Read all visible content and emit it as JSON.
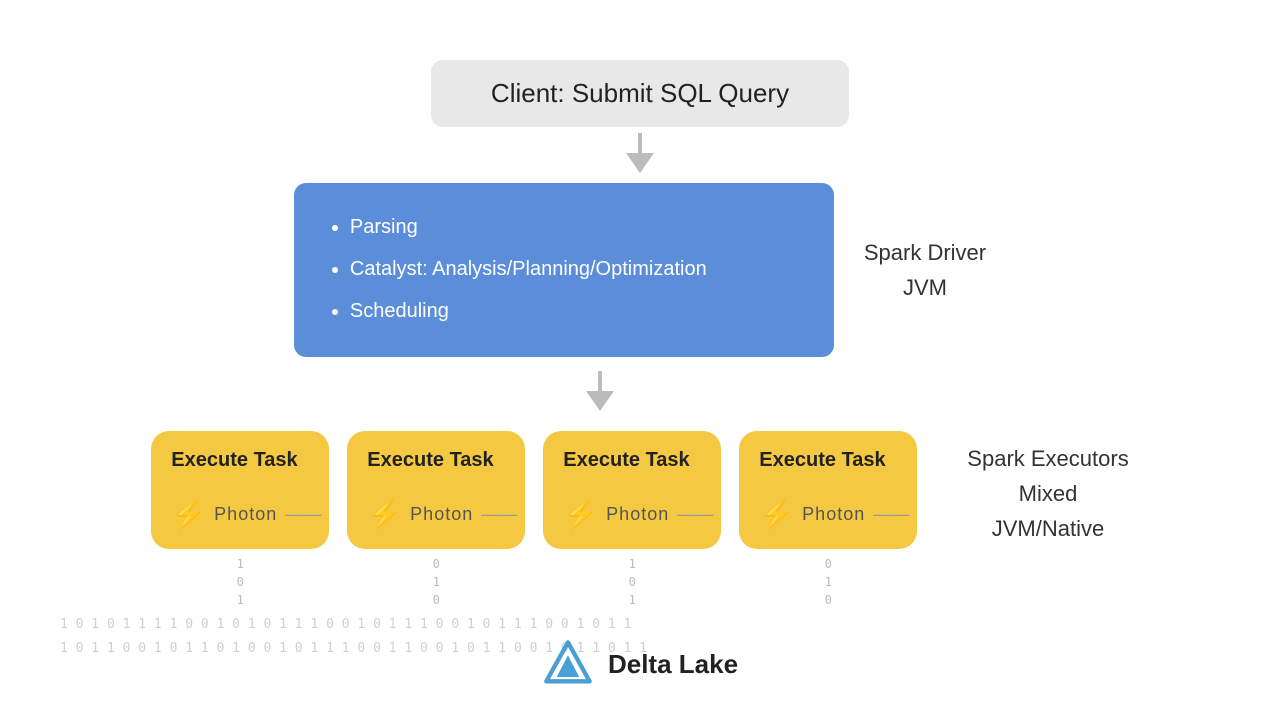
{
  "client": {
    "label": "Client: Submit SQL Query"
  },
  "driver": {
    "items": [
      "Parsing",
      "Catalyst: Analysis/Planning/Optimization",
      "Scheduling"
    ],
    "label_line1": "Spark Driver",
    "label_line2": "JVM"
  },
  "executors": {
    "boxes": [
      {
        "title": "Execute Task",
        "photon": "Photon",
        "binary": [
          "1",
          "0",
          "1"
        ]
      },
      {
        "title": "Execute Task",
        "photon": "Photon",
        "binary": [
          "0",
          "1",
          "0"
        ]
      },
      {
        "title": "Execute Task",
        "photon": "Photon",
        "binary": [
          "1",
          "0",
          "1"
        ]
      },
      {
        "title": "Execute Task",
        "photon": "Photon",
        "binary": [
          "0",
          "1",
          "0"
        ]
      }
    ],
    "label_line1": "Spark Executors",
    "label_line2": "Mixed",
    "label_line3": "JVM/Native"
  },
  "binary_rows": [
    "1 0 1 0 1 1 1 1 0 0 1 0   1 0 1 1 1 0 0 1 0 1 1 1 0 0 1 0 1 1 1 0 0 1 0 1 1",
    "1 0 1 1 0 0 1 0 1 1 0 1   0 0 1 0 1 1 1 0 0 1 1 0 0 1 0 1 1 0 0 1 0 1 1 0 1 1"
  ],
  "delta_lake": {
    "label": "Delta Lake"
  }
}
